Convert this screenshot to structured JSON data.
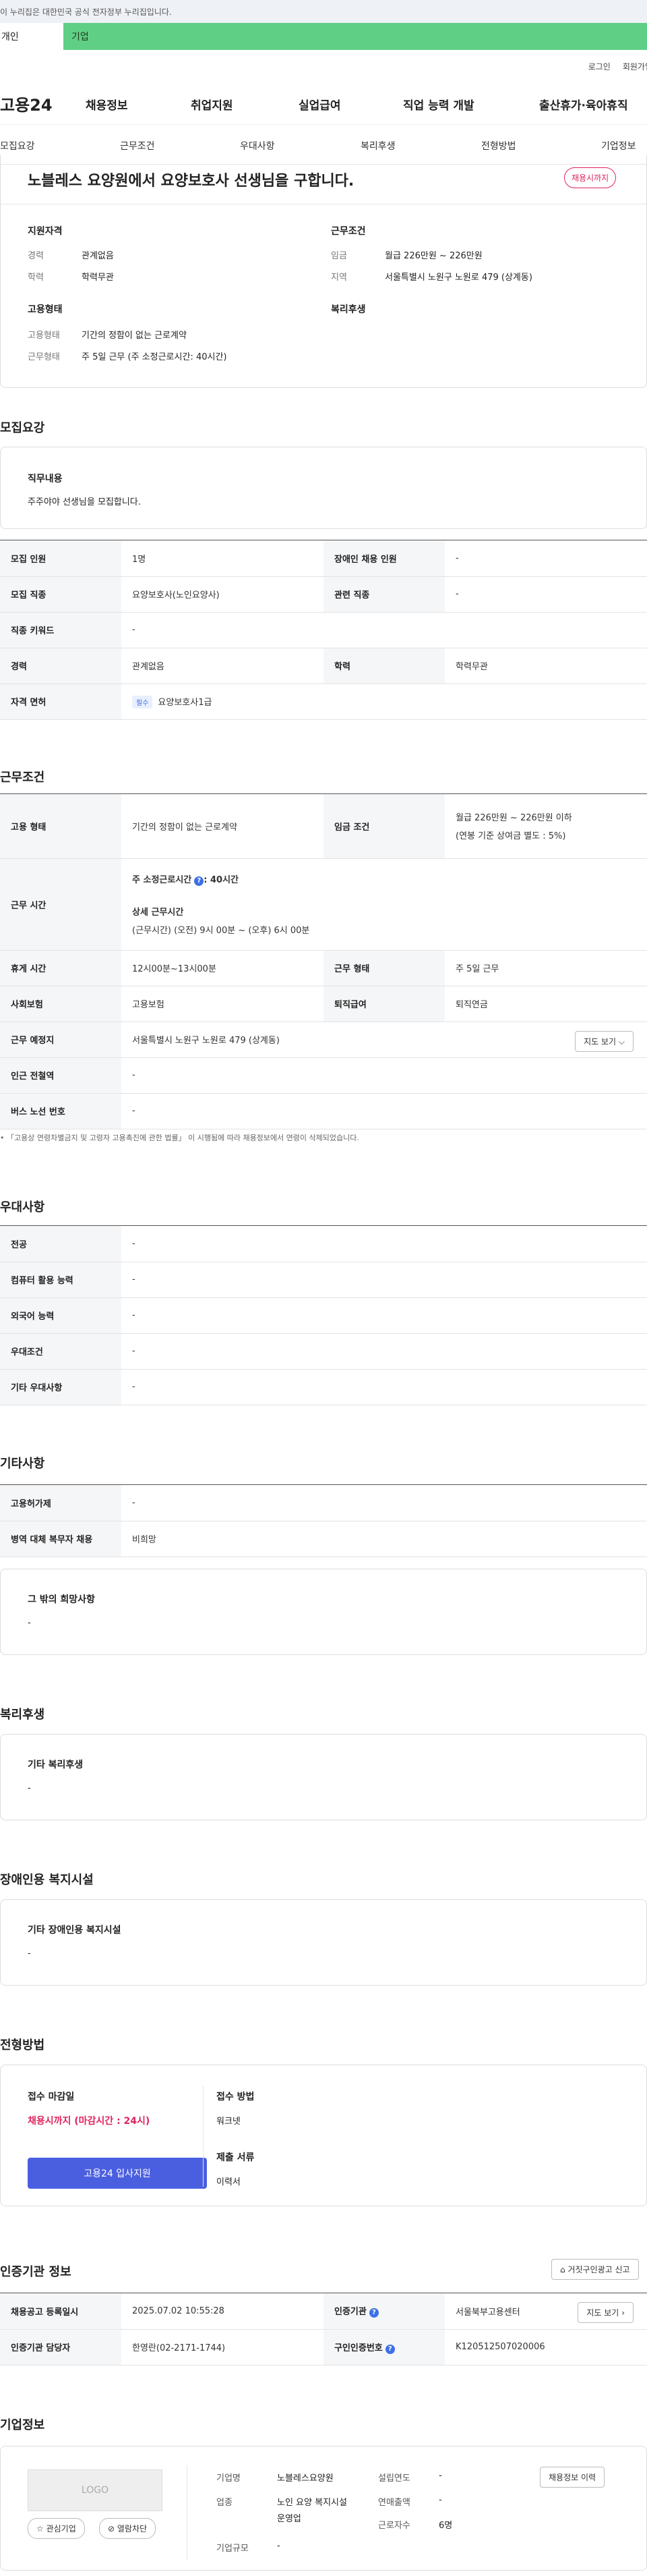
{
  "gov_banner": "이 누리집은 대한민국 공식 전자정부 누리집입니다.",
  "tabs": {
    "personal": "개인",
    "company": "기업"
  },
  "util": {
    "login": "로그인",
    "join": "회원가입"
  },
  "logo": "고용24",
  "gnb": [
    "채용정보",
    "취업지원",
    "실업급여",
    "직업 능력 개발",
    "출산휴가·육아휴직"
  ],
  "subnav": [
    "모집요강",
    "근무조건",
    "우대사항",
    "복리후생",
    "전형방법",
    "기업정보"
  ],
  "summary": {
    "title": "노블레스 요양원에서 요양보호사 선생님을 구합니다.",
    "badge": "채용시까지",
    "qual_title": "지원자격",
    "career_label": "경력",
    "career": "관계없음",
    "edu_label": "학력",
    "edu": "학력무관",
    "cond_title": "근무조건",
    "wage_label": "임금",
    "wage": "월급 226만원 ~ 226만원",
    "region_label": "지역",
    "region": "서울특별시 노원구 노원로 479 (상계동)",
    "emp_title": "고용형태",
    "emptype_label": "고용형태",
    "emptype": "기간의 정함이 없는 근로계약",
    "worktype_label": "근무형태",
    "worktype": "주 5일 근무 (주 소정근로시간: 40시간)",
    "welfare_title": "복리후생"
  },
  "recruit": {
    "title": "모집요강",
    "duty_label": "직무내용",
    "duty": "주주야야 선생님을 모집합니다.",
    "rows": [
      {
        "k1": "모집 인원",
        "v1": "1명",
        "k2": "장애인 채용 인원",
        "v2": "-"
      },
      {
        "k1": "모집 직종",
        "v1": "요양보호사(노인요양사)",
        "k2": "관련 직종",
        "v2": "-"
      },
      {
        "k1": "직종 키워드",
        "v1": "-"
      },
      {
        "k1": "경력",
        "v1": "관계없음",
        "k2": "학력",
        "v2": "학력무관"
      },
      {
        "k1": "자격 면허",
        "chip": "필수",
        "v1": "요양보호사1급"
      }
    ]
  },
  "conditions": {
    "title": "근무조건",
    "emp_k": "고용 형태",
    "emp_v": "기간의 정함이 없는 근로계약",
    "wage_k": "임금 조건",
    "wage_v1": "월급 226만원 ~ 226만원 이하",
    "wage_v2": "(연봉 기준 상여금 별도 : 5%)",
    "hours_k": "근무 시간",
    "hours_l1": "주 소정근로시간",
    "hours_l1v": ": 40시간",
    "hours_l2": "상세 근무시간",
    "hours_l3": "(근무시간) (오전) 9시 00분 ~ (오후) 6시 00분",
    "break_k": "휴게 시간",
    "break_v": "12시00분~13시00분",
    "form_k": "근무 형태",
    "form_v": "주 5일 근무",
    "ins_k": "사회보험",
    "ins_v": "고용보험",
    "ret_k": "퇴직급여",
    "ret_v": "퇴직연금",
    "place_k": "근무 예정지",
    "place_v": "서울특별시 노원구 노원로 479 (상계동)",
    "map_btn": "지도 보기",
    "subway_k": "인근 전철역",
    "subway_v": "-",
    "bus_k": "버스 노선 번호",
    "bus_v": "-",
    "note": "「고용상 연령차별금지 및 고령자 고용촉진에 관한 법률」 이 시행됨에 따라 채용정보에서 연령이 삭제되었습니다."
  },
  "pref": {
    "title": "우대사항",
    "rows": [
      [
        "전공",
        "-"
      ],
      [
        "컴퓨터 활용 능력",
        "-"
      ],
      [
        "외국어 능력",
        "-"
      ],
      [
        "우대조건",
        "-"
      ],
      [
        "기타 우대사항",
        "-"
      ]
    ]
  },
  "etc": {
    "title": "기타사항",
    "rows": [
      [
        "고용허가제",
        "-"
      ],
      [
        "병역 대체 복무자 채용",
        "비희망"
      ]
    ],
    "other_label": "그 밖의 희망사항",
    "other_v": "-"
  },
  "welfare": {
    "title": "복리후생",
    "label": "기타 복리후생",
    "v": "-"
  },
  "disabled": {
    "title": "장애인용 복지시설",
    "label": "기타 장애인용 복지시설",
    "v": "-"
  },
  "process": {
    "title": "전형방법",
    "deadline_label": "접수 마감일",
    "deadline": "채용시까지 (마감시간 : 24시)",
    "apply_btn": "고용24 입사지원",
    "method_label": "접수 방법",
    "method": "워크넷",
    "docs_label": "제출 서류",
    "docs": "이력서"
  },
  "agency": {
    "title": "인증기관 정보",
    "report_btn": "거짓구인광고 신고",
    "reg_k": "채용공고 등록일시",
    "reg_v": "2025.07.02 10:55:28",
    "org_k": "인증기관",
    "org_v": "서울북부고용센터",
    "map_btn": "지도 보기",
    "mgr_k": "인증기관 담당자",
    "mgr_v": "한영란(02-2171-1744)",
    "no_k": "구인인증번호",
    "no_v": "K120512507020006"
  },
  "company": {
    "title": "기업정보",
    "logo": "LOGO",
    "fav_btn": "관심기업",
    "block_btn": "열람차단",
    "name_k": "기업명",
    "name_v": "노블레스요양원",
    "ind_k": "업종",
    "ind_v": "노인 요양 복지시설 운영업",
    "size_k": "기업규모",
    "size_v": "-",
    "year_k": "설립연도",
    "year_v": "-",
    "sales_k": "연매출액",
    "sales_v": "-",
    "emp_k": "근로자수",
    "emp_v": "6명",
    "history_btn": "채용정보 이력"
  }
}
